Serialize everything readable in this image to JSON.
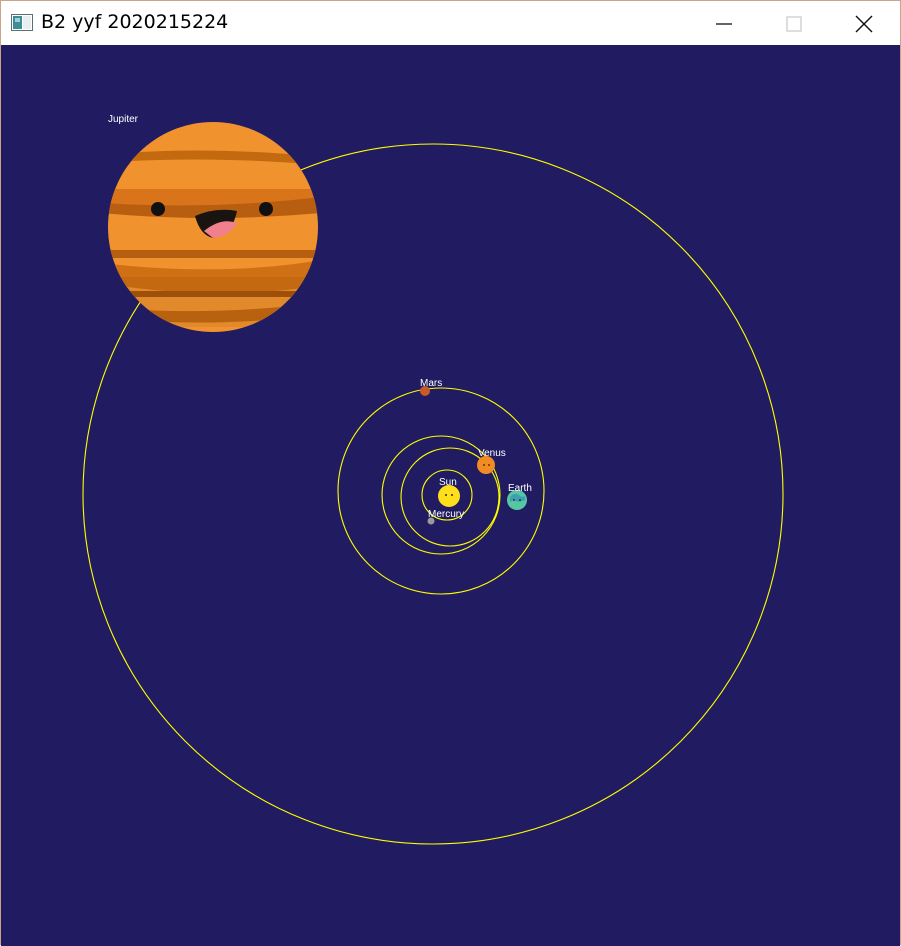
{
  "window": {
    "title": "B2 yyf 2020215224",
    "controls": {
      "minimize": "minimize-icon",
      "maximize": "maximize-icon",
      "close": "close-icon"
    }
  },
  "scene": {
    "background_color": "#211c61",
    "orbit_color": "#ffff00",
    "labels": {
      "sun": "Sun",
      "mercury": "Mercury",
      "venus": "Venus",
      "earth": "Earth",
      "mars": "Mars",
      "jupiter": "Jupiter"
    },
    "colors": {
      "sun": "#ffdf1c",
      "mercury": "#9a9a9a",
      "venus": "#f08c22",
      "earth": "#57c7a2",
      "mars": "#c65a28",
      "jupiter": "#f0922e"
    }
  }
}
